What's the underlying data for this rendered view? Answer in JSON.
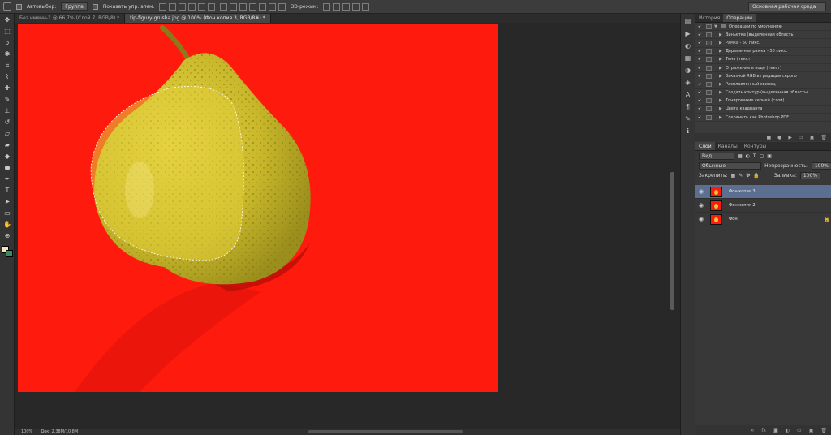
{
  "options_bar": {
    "autoselect_label": "Автовыбор:",
    "autoselect_value": "Группа",
    "show_controls_label": "Показать упр. элем.",
    "mode3d_label": "3D-режим:",
    "workspace": "Основная рабочая среда"
  },
  "tabs": [
    {
      "label": "Без имени-1 @ 66,7% (Слой 7, RGB/8) *",
      "active": false
    },
    {
      "label": "tip-figury-grusha.jpg @ 100% (Фон копия 3, RGB/8#) *",
      "active": true
    }
  ],
  "status": {
    "zoom": "100%",
    "doc": "Док: 2,38M/10,8M"
  },
  "tools": [
    "move-tool",
    "marquee-tool",
    "lasso-tool",
    "quick-select-tool",
    "crop-tool",
    "eyedropper-tool",
    "healing-tool",
    "brush-tool",
    "stamp-tool",
    "history-brush-tool",
    "eraser-tool",
    "gradient-tool",
    "blur-tool",
    "dodge-tool",
    "pen-tool",
    "type-tool",
    "path-select-tool",
    "shape-tool",
    "hand-tool",
    "zoom-tool"
  ],
  "actions_panel": {
    "tabs": [
      "История",
      "Операции"
    ],
    "set_name": "Операции по умолчанию",
    "items": [
      "Виньетка (выделенная область)",
      "Рамка - 50 пикс.",
      "Деревянная рамка - 50 пикс.",
      "Тень (текст)",
      "Отражение в воде (текст)",
      "Заказной RGB в градации серого",
      "Расплавленный свинец",
      "Создать контур (выделенная область)",
      "Тонирование сепией (слой)",
      "Цвета квадранта",
      "Сохранить как Photoshop PDF"
    ]
  },
  "layers_panel": {
    "tabs": [
      "Слои",
      "Каналы",
      "Контуры"
    ],
    "filter": "Вид",
    "blend_mode": "Обычные",
    "opacity_label": "Непрозрачность:",
    "opacity": "100%",
    "lock_label": "Закрепить:",
    "fill_label": "Заливка:",
    "fill": "100%",
    "layers": [
      {
        "name": "Фон копия 3",
        "selected": true
      },
      {
        "name": "Фон копия 2",
        "selected": false
      },
      {
        "name": "Фон",
        "selected": false
      }
    ]
  },
  "colors": {
    "canvas_bg": "#ff1a0e",
    "pear": "#d7c22a",
    "selection_highlight": "#5d6f90"
  }
}
